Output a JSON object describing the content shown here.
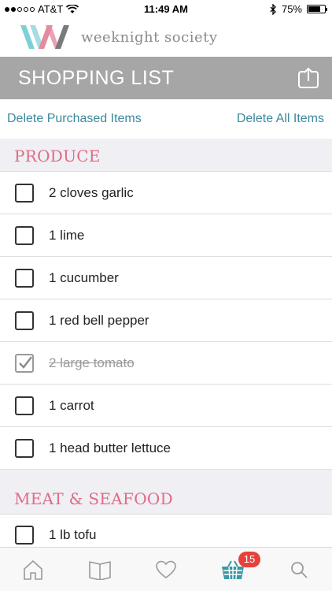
{
  "status_bar": {
    "carrier": "AT&T",
    "time": "11:49 AM",
    "battery": "75%",
    "battery_level": 0.75,
    "signal_dots_filled": 2,
    "signal_dots_total": 5
  },
  "brand": {
    "name": "weeknight society",
    "logo_icon": "wn-logo-icon",
    "logo_colors": [
      "#7fd0d6",
      "#e58aa0",
      "#7a7a7a"
    ]
  },
  "header": {
    "title": "SHOPPING LIST",
    "share_icon": "share-icon",
    "background": "#a6a6a6"
  },
  "actions": {
    "delete_purchased": "Delete Purchased Items",
    "delete_all": "Delete All Items",
    "link_color": "#3a8a9a"
  },
  "sections": [
    {
      "title": "PRODUCE",
      "items": [
        {
          "label": "2 cloves garlic",
          "checked": false
        },
        {
          "label": "1 lime",
          "checked": false
        },
        {
          "label": "1 cucumber",
          "checked": false
        },
        {
          "label": "1 red bell pepper",
          "checked": false
        },
        {
          "label": "2 large tomato",
          "checked": true
        },
        {
          "label": "1 carrot",
          "checked": false
        },
        {
          "label": "1 head butter lettuce",
          "checked": false
        }
      ]
    },
    {
      "title": "MEAT & SEAFOOD",
      "items": [
        {
          "label": "1 lb tofu",
          "checked": false
        }
      ]
    }
  ],
  "tab_bar": {
    "tabs": [
      {
        "icon": "home-icon"
      },
      {
        "icon": "book-icon"
      },
      {
        "icon": "heart-icon"
      },
      {
        "icon": "basket-icon",
        "active": true
      },
      {
        "icon": "search-icon"
      }
    ],
    "badge_count": "15",
    "active_color": "#3a9aa6",
    "badge_color": "#e8413b"
  }
}
